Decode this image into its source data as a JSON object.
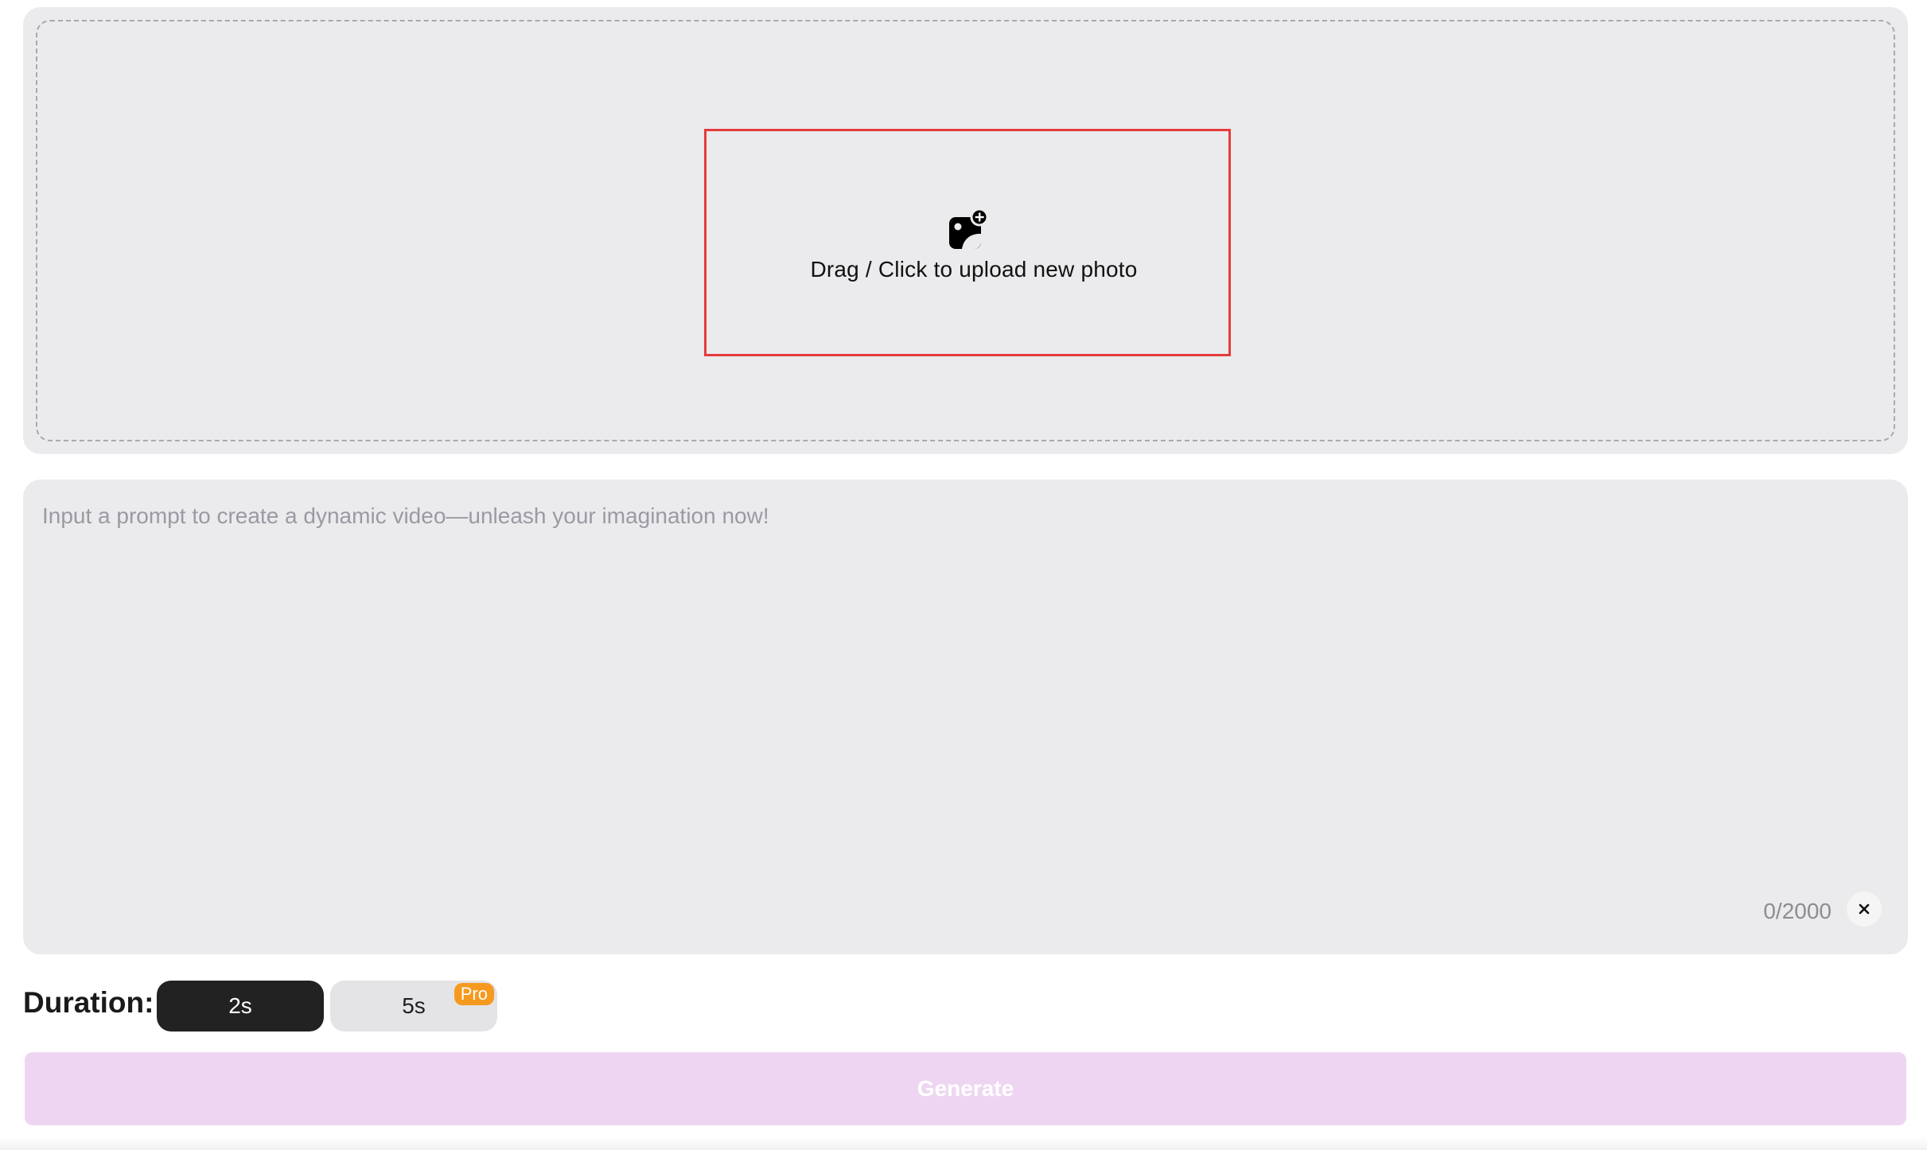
{
  "upload": {
    "label": "Drag / Click to upload new photo",
    "icon": "add-photo-icon"
  },
  "prompt": {
    "value": "",
    "placeholder": "Input a prompt to create a dynamic video—unleash your imagination now!",
    "counter": "0/2000",
    "clear_icon": "close-icon"
  },
  "duration": {
    "label": "Duration:",
    "options": [
      {
        "label": "2s",
        "selected": true
      },
      {
        "label": "5s",
        "selected": false,
        "badge": "Pro"
      }
    ]
  },
  "generate": {
    "label": "Generate"
  },
  "colors": {
    "panel_bg": "#ebeaec",
    "highlight_border": "#e53b3b",
    "selected_option_bg": "#222222",
    "pro_badge": "#f59a1f",
    "generate_bg": "#eed6f2"
  }
}
